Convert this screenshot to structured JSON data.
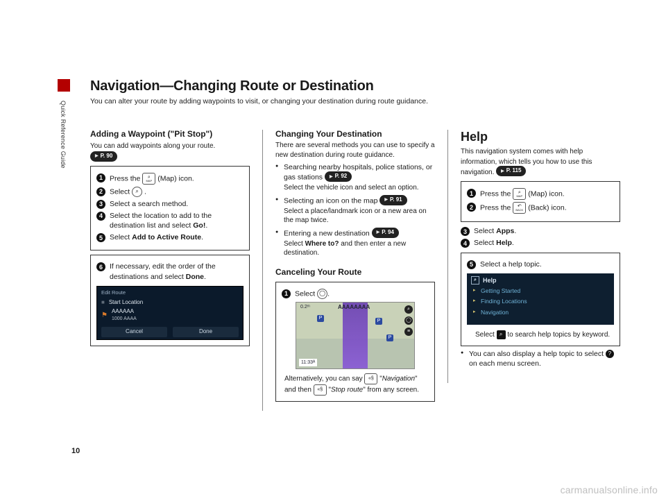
{
  "meta": {
    "side_label": "Quick Reference Guide",
    "page_number": "10",
    "watermark": "carmanualsonline.info"
  },
  "header": {
    "title": "Navigation—Changing Route or Destination",
    "subtitle": "You can alter your route by adding waypoints to visit, or changing your destination during route guidance."
  },
  "col1": {
    "heading": "Adding a Waypoint (\"Pit Stop\")",
    "lead": "You can add waypoints along your route.",
    "ref": "P. 90",
    "steps_box1": {
      "s1a": "Press the ",
      "s1_icon_top": "⌕",
      "s1_icon_bottom": "MAP",
      "s1b": " (Map) icon.",
      "s2a": "Select ",
      "s2_icon": "⌕",
      "s2b": ".",
      "s3": "Select a search method.",
      "s4a": "Select the location to add to the destination list and select ",
      "s4b": "Go!",
      "s4c": ".",
      "s5a": "Select ",
      "s5b": "Add to Active Route",
      "s5c": "."
    },
    "steps_box2": {
      "s6a": "If necessary, edit the order of the destinations and select ",
      "s6b": "Done",
      "s6c": "."
    },
    "nav_screenshot": {
      "top": "Edit Route",
      "start": "Start Location",
      "dest_line1": "AAAAAA",
      "dest_line2": "1000 AAAA",
      "btn_cancel": "Cancel",
      "btn_done": "Done"
    }
  },
  "col2": {
    "heading": "Changing Your Destination",
    "lead": "There are several methods you can use to specify a new destination during route guidance.",
    "b1a": "Searching nearby hospitals, police stations, or gas stations ",
    "b1_ref": "P. 92",
    "b1b": "Select the vehicle icon and select an option.",
    "b2a": "Selecting an icon on the map ",
    "b2_ref": "P. 91",
    "b2b": "Select a place/landmark icon or a new area on the map twice.",
    "b3a": "Entering a new destination ",
    "b3_ref": "P. 94",
    "b3b_pre": "Select ",
    "b3b_bold": "Where to?",
    "b3b_post": " and then enter a new destination.",
    "cancel_heading": "Canceling Your Route",
    "cancel_step_a": "Select ",
    "cancel_step_b": ".",
    "map": {
      "dist": "0.2ᵐ",
      "dest": "AAAAAAAA",
      "time": "11:33ᴬ"
    },
    "alt_a": "Alternatively, you can say ",
    "alt_b": " \"",
    "alt_nav": "Navigation",
    "alt_c": "\" and then ",
    "alt_d": " \"",
    "alt_stop": "Stop route",
    "alt_e": "\" from any screen."
  },
  "col3": {
    "heading": "Help",
    "lead": "This navigation system comes with help information, which tells you how to use this navigation. ",
    "ref": "P. 115",
    "box1": {
      "s1a": "Press the ",
      "s1b": " (Map) icon.",
      "s2a": "Press the ",
      "s2_icon": "↶",
      "s2_label": "BACK",
      "s2b": " (Back) icon."
    },
    "mid": {
      "s3a": "Select ",
      "s3b": "Apps",
      "s3c": ".",
      "s4a": "Select ",
      "s4b": "Help",
      "s4c": "."
    },
    "box2": {
      "s5": "Select a help topic.",
      "help_header": "Help",
      "items": [
        "Getting Started",
        "Finding Locations",
        "Navigation"
      ],
      "note_a": "Select ",
      "note_b": " to search help topics by keyword."
    },
    "tail_a": "You can also display a help topic to select ",
    "tail_b": " on each menu screen."
  }
}
